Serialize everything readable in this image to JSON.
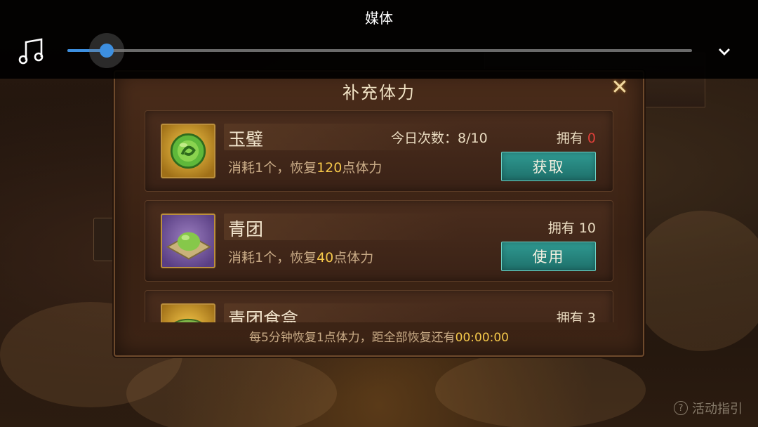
{
  "media": {
    "title": "媒体",
    "progress_fraction": 0.063,
    "music_icon": "music-note-icon",
    "collapse_icon": "chevron-down-icon"
  },
  "background": {
    "activity_guide_label": "活动指引"
  },
  "panel": {
    "title": "补充体力",
    "close_icon": "close-icon",
    "items": [
      {
        "name": "玉璧",
        "today_label": "今日次数：",
        "today_value": "8/10",
        "own_label": "拥有",
        "own_value": "0",
        "desc_prefix": "消耗1个，恢复",
        "desc_amount": "120",
        "desc_suffix": "点体力",
        "button": "获取",
        "icon": "jade-disc-icon"
      },
      {
        "name": "青团",
        "own_label": "拥有",
        "own_value": "10",
        "desc_prefix": "消耗1个，恢复",
        "desc_amount": "40",
        "desc_suffix": "点体力",
        "button": "使用",
        "icon": "green-rice-ball-icon"
      },
      {
        "name": "青团食盒",
        "own_label": "拥有",
        "own_value": "3",
        "icon": "food-box-icon"
      }
    ],
    "footer_text": "每5分钟恢复1点体力，距全部恢复还有",
    "footer_time": "00:00:00"
  },
  "colors": {
    "accent_blue": "#3d8fe0",
    "button_teal": "#2f9a92",
    "highlight_gold": "#f5c84a",
    "zero_red": "#e0403a"
  }
}
